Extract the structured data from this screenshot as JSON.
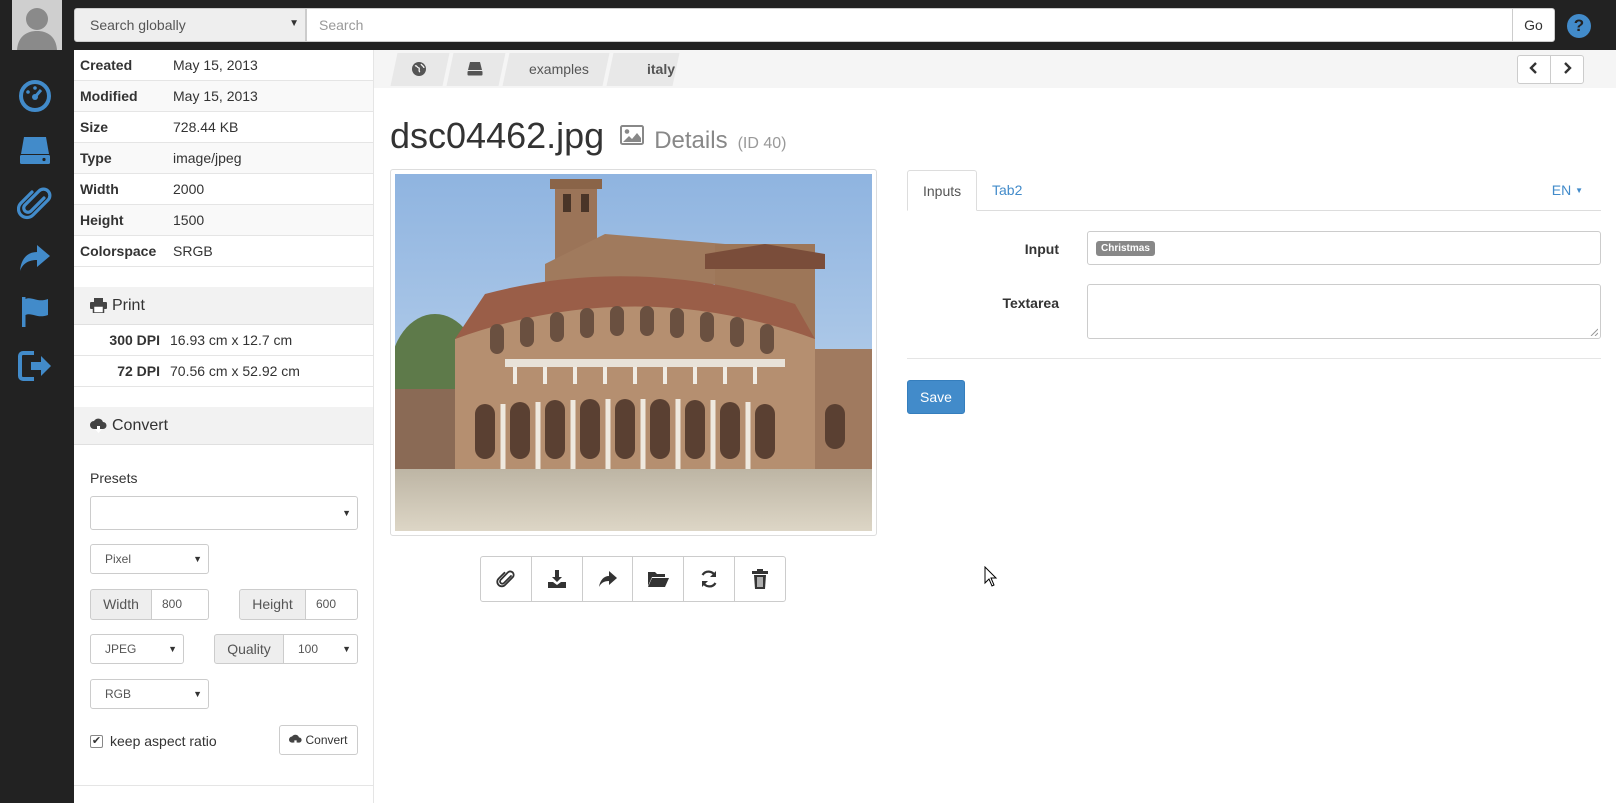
{
  "topbar": {
    "search_scope": "Search globally",
    "search_placeholder": "Search",
    "go_label": "Go",
    "help_label": "?"
  },
  "nav": {
    "items": [
      "dashboard-icon",
      "storage-icon",
      "attachment-icon",
      "share-icon",
      "flag-icon",
      "logout-icon"
    ]
  },
  "info": {
    "rows": [
      {
        "k": "Created",
        "v": "May 15, 2013"
      },
      {
        "k": "Modified",
        "v": "May 15, 2013"
      },
      {
        "k": "Size",
        "v": "728.44 KB"
      },
      {
        "k": "Type",
        "v": "image/jpeg"
      },
      {
        "k": "Width",
        "v": "2000"
      },
      {
        "k": "Height",
        "v": "1500"
      },
      {
        "k": "Colorspace",
        "v": "SRGB"
      }
    ]
  },
  "print": {
    "title": "Print",
    "rows": [
      {
        "k": "300 DPI",
        "v": "16.93 cm x 12.7 cm"
      },
      {
        "k": "72 DPI",
        "v": "70.56 cm x 52.92 cm"
      }
    ]
  },
  "convert": {
    "title": "Convert",
    "presets_label": "Presets",
    "presets_value": "",
    "unit": "Pixel",
    "width_label": "Width",
    "width_value": "800",
    "height_label": "Height",
    "height_value": "600",
    "format": "JPEG",
    "quality_label": "Quality",
    "quality_value": "100",
    "colorspace": "RGB",
    "keep_aspect_label": "keep aspect ratio",
    "keep_aspect_checked": true,
    "button_label": "Convert"
  },
  "breadcrumb": {
    "items": [
      "examples",
      "italy"
    ]
  },
  "title": {
    "filename": "dsc04462.jpg",
    "details": "Details",
    "id": "(ID 40)"
  },
  "toolbar": {
    "buttons": [
      "paperclip-icon",
      "download-icon",
      "share-icon",
      "folder-open-icon",
      "refresh-icon",
      "trash-icon"
    ]
  },
  "tabs": {
    "items": [
      "Inputs",
      "Tab2"
    ],
    "active": "Inputs",
    "language": "EN"
  },
  "form": {
    "input_label": "Input",
    "input_tag": "Christmas",
    "textarea_label": "Textarea",
    "textarea_value": "",
    "save_label": "Save"
  },
  "colors": {
    "accent": "#428bca",
    "dark": "#222222"
  }
}
